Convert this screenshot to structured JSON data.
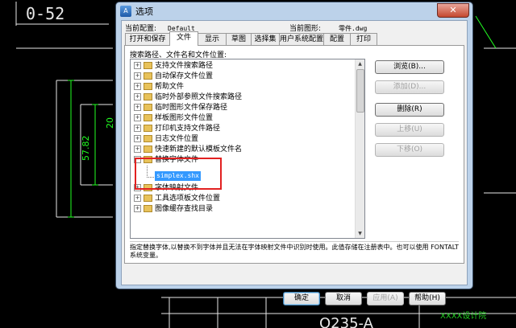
{
  "window": {
    "title": "选项",
    "close_label": "✕"
  },
  "profile": {
    "label": "当前配置:",
    "value": "Default"
  },
  "drawing": {
    "label": "当前图形:",
    "value": "零件.dwg"
  },
  "tabs": [
    "打开和保存",
    "文件",
    "显示",
    "草图",
    "选择集",
    "用户系统配置",
    "配置",
    "打印"
  ],
  "active_tab": "文件",
  "panel": {
    "header": "搜索路径、文件名和文件位置:"
  },
  "tree": {
    "items": [
      "支持文件搜索路径",
      "自动保存文件位置",
      "帮助文件",
      "临时外部参照文件搜索路径",
      "临时图形文件保存路径",
      "样板图形文件位置",
      "打印机支持文件路径",
      "日志文件位置",
      "快速新建的默认模板文件名",
      "替换字体文件",
      "字体映射文件",
      "工具选项板文件位置",
      "图像缓存查找目录"
    ],
    "expanded_item": "替换字体文件",
    "selected_child": "simplex.shx"
  },
  "side_buttons": [
    "浏览(B)...",
    "添加(D)...",
    "删除(R)",
    "上移(U)",
    "下移(O)"
  ],
  "description": "指定替换字体,以替换不到字体并且无法在字体映射文件中识别时使用。此值存储在注册表中。也可以使用 FONTALT 系统变量。",
  "bottom_buttons": [
    "确定",
    "取消",
    "应用(A)",
    "帮助(H)"
  ],
  "cad": {
    "dim_top": "0-52",
    "dim_20": "20",
    "dim_57": "57.82",
    "material": "Q235-A",
    "corner_text": "XXXX设计院"
  },
  "colors": {
    "cad_line": "#22ff22",
    "cad_white": "#e8e8e8",
    "highlight": "#e22121",
    "selection": "#3399ff"
  }
}
